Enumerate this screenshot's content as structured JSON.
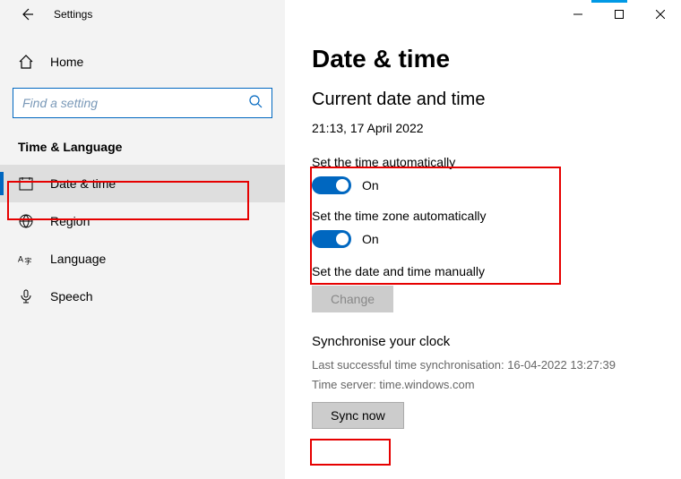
{
  "window": {
    "title": "Settings"
  },
  "sidebar": {
    "home": "Home",
    "search_placeholder": "Find a setting",
    "category": "Time & Language",
    "items": [
      {
        "label": "Date & time",
        "icon": "calendar-icon"
      },
      {
        "label": "Region",
        "icon": "globe-icon"
      },
      {
        "label": "Language",
        "icon": "language-icon"
      },
      {
        "label": "Speech",
        "icon": "microphone-icon"
      }
    ]
  },
  "main": {
    "heading": "Date & time",
    "subheading": "Current date and time",
    "current_datetime": "21:13, 17 April 2022",
    "auto_time_label": "Set the time automatically",
    "auto_time_state": "On",
    "auto_tz_label": "Set the time zone automatically",
    "auto_tz_state": "On",
    "manual_label": "Set the date and time manually",
    "change_btn": "Change",
    "sync_heading": "Synchronise your clock",
    "sync_last": "Last successful time synchronisation: 16-04-2022 13:27:39",
    "sync_server": "Time server: time.windows.com",
    "sync_btn": "Sync now"
  }
}
